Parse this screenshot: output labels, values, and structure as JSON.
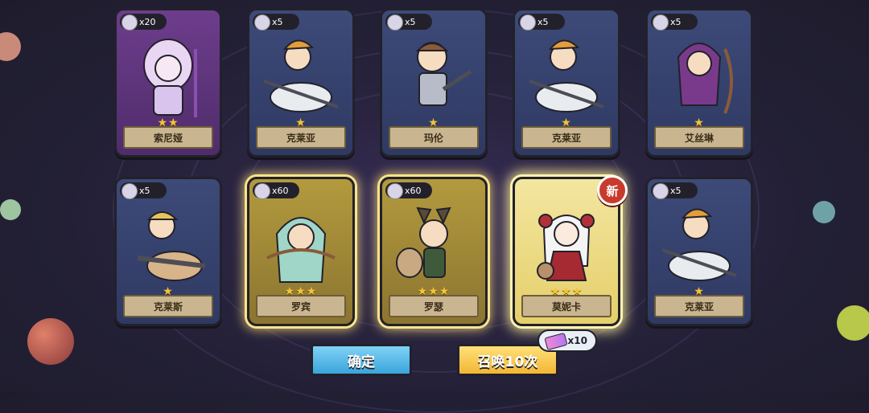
{
  "cards": [
    {
      "name": "索尼娅",
      "count": "x20",
      "stars": "★★",
      "rarity": "purple"
    },
    {
      "name": "克莱亚",
      "count": "x5",
      "stars": "★",
      "rarity": "blue"
    },
    {
      "name": "玛伦",
      "count": "x5",
      "stars": "★",
      "rarity": "blue"
    },
    {
      "name": "克莱亚",
      "count": "x5",
      "stars": "★",
      "rarity": "blue"
    },
    {
      "name": "艾丝琳",
      "count": "x5",
      "stars": "★",
      "rarity": "blue"
    },
    {
      "name": "克莱斯",
      "count": "x5",
      "stars": "★",
      "rarity": "blue"
    },
    {
      "name": "罗宾",
      "count": "x60",
      "stars": "★★★",
      "rarity": "gold"
    },
    {
      "name": "罗瑟",
      "count": "x60",
      "stars": "★★★",
      "rarity": "gold"
    },
    {
      "name": "莫妮卡",
      "count": "",
      "stars": "★★★",
      "rarity": "bright",
      "badge": "新"
    },
    {
      "name": "克莱亚",
      "count": "x5",
      "stars": "★",
      "rarity": "blue"
    }
  ],
  "buttons": {
    "confirm": "确定",
    "summon": "召唤10次"
  },
  "cost": {
    "amount": "x10",
    "icon": "ticket-icon"
  },
  "colors": {
    "gold_glow": "#fbe38a",
    "blue_card": "#2f3a63",
    "purple_card": "#4f2c6b"
  }
}
